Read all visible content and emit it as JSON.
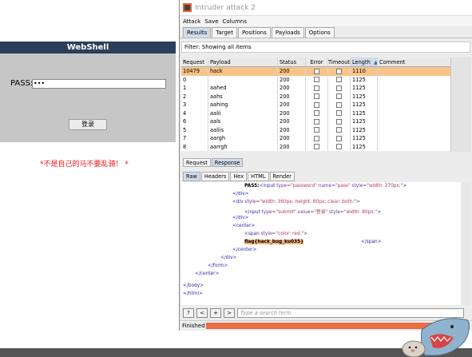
{
  "webshell": {
    "title": "WebShell",
    "pass_label": "PASS:",
    "pass_value": "•••",
    "login_button": "登录",
    "warning": "*不是自己的马不要乱骑！ *"
  },
  "burp": {
    "window_title": "Intruder attack 2",
    "menu": [
      "Attack",
      "Save",
      "Columns"
    ],
    "tabs": [
      "Results",
      "Target",
      "Positions",
      "Payloads",
      "Options"
    ],
    "filter": "Filter: Showing all items",
    "columns": [
      "Request",
      "Payload",
      "Status",
      "Error",
      "Timeout",
      "Length",
      "Comment"
    ],
    "sort_indicator": "▲",
    "rows": [
      {
        "request": "10479",
        "payload": "hack",
        "status": "200",
        "length": "1110",
        "highlight": true
      },
      {
        "request": "0",
        "payload": "",
        "status": "200",
        "length": "1125"
      },
      {
        "request": "1",
        "payload": "aahed",
        "status": "200",
        "length": "1125"
      },
      {
        "request": "2",
        "payload": "aahs",
        "status": "200",
        "length": "1125"
      },
      {
        "request": "3",
        "payload": "aahing",
        "status": "200",
        "length": "1125"
      },
      {
        "request": "4",
        "payload": "aalii",
        "status": "200",
        "length": "1125"
      },
      {
        "request": "6",
        "payload": "aals",
        "status": "200",
        "length": "1125"
      },
      {
        "request": "5",
        "payload": "aaliis",
        "status": "200",
        "length": "1125"
      },
      {
        "request": "7",
        "payload": "aargh",
        "status": "200",
        "length": "1125"
      },
      {
        "request": "8",
        "payload": "aarrgh",
        "status": "200",
        "length": "1125"
      }
    ],
    "req_res_tabs": [
      "Request",
      "Response"
    ],
    "view_tabs": [
      "Raw",
      "Headers",
      "Hex",
      "HTML",
      "Render"
    ],
    "code": {
      "l1_label": "PASS:",
      "l1_tag_open": "<input",
      "l1_attr1": " type=",
      "l1_val1": "\"password\"",
      "l1_attr2": " name=",
      "l1_val2": "\"pass\"",
      "l1_attr3": " style=",
      "l1_val3": "\"width: 270px;\"",
      "l1_tag_close": ">",
      "l2": "</div>",
      "l3_tag_open": "<div",
      "l3_attr": " style=",
      "l3_val": "\"width: 360px; height: 80px; clear: both;\"",
      "l3_tag_close": ">",
      "l4_tag_open": "<input",
      "l4_attr1": " type=",
      "l4_val1": "\"submit\"",
      "l4_attr2": " value=",
      "l4_val2": "\"登录\"",
      "l4_attr3": " style=",
      "l4_val3": "\"width: 80px;\"",
      "l4_tag_close": ">",
      "l5": "</div>",
      "l6": "<center>",
      "l7_tag_open": "<span",
      "l7_attr": " style=",
      "l7_val": "\"color: red;\"",
      "l7_tag_close": ">",
      "l8_flag": "flag{hack_bug_ku035}",
      "l8_close": "</span>",
      "l9": "</center>",
      "l10": "</div>",
      "l11": "</form>",
      "l12": "</center>",
      "l13": "</body>",
      "l14": "</html>"
    },
    "nav_buttons": [
      "?",
      "<",
      "+",
      ">"
    ],
    "search_placeholder": "Type a search term",
    "status_text": "Finished",
    "progress": 1.0
  },
  "colors": {
    "accent_orange": "#ee6f3d",
    "header_blue": "#2b3f5c",
    "warning_red": "#ee1111",
    "highlight_row": "#f8c488"
  }
}
